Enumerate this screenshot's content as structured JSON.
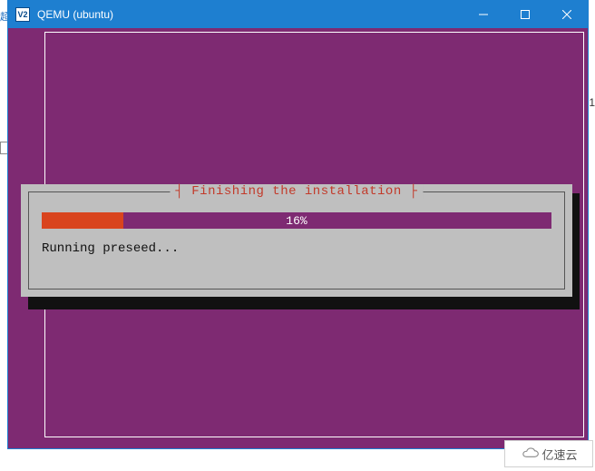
{
  "window": {
    "title": "QEMU (ubuntu)",
    "icon_label": "V2"
  },
  "installer": {
    "dialog_title": "Finishing the installation",
    "progress_percent": 16,
    "progress_label": "16%",
    "status": "Running preseed..."
  },
  "watermark": {
    "text": "亿速云"
  },
  "edge": {
    "right_num": "1",
    "left_txt": "超"
  },
  "colors": {
    "titlebar": "#1e7fd0",
    "installer_bg": "#7e2a72",
    "progress_fill": "#d9441e",
    "dialog_bg": "#bfbfbf",
    "dialog_title": "#c23a2a"
  }
}
